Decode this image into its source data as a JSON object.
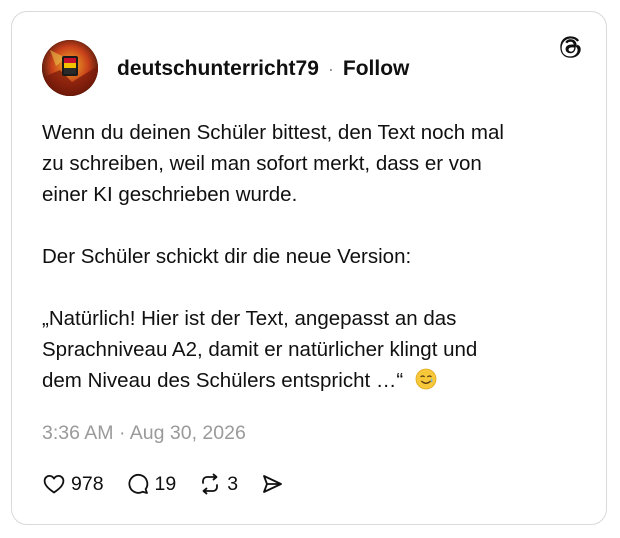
{
  "post": {
    "username": "deutschunterricht79",
    "separator": "·",
    "follow_label": "Follow",
    "paragraphs": [
      [
        "Wenn du deinen Schüler bittest, den Text noch mal",
        "zu schreiben, weil man sofort merkt, dass er von",
        "einer KI geschrieben wurde."
      ],
      [
        "Der Schüler schickt dir die neue Version:"
      ],
      [
        "„Natürlich! Hier ist der Text, angepasst an das",
        "Sprachniveau A2, damit er natürlicher klingt und",
        "dem Niveau des Schülers entspricht …“"
      ]
    ],
    "emoji": "smiling-face-with-tear",
    "timestamp": "3:36 AM · Aug 30, 2026"
  },
  "actions": {
    "likes": "978",
    "replies": "19",
    "reposts": "3"
  },
  "icons": {
    "brand_logo": "threads-logo-icon",
    "like": "heart-icon",
    "reply": "speech-bubble-icon",
    "repost": "repost-icon",
    "share": "send-icon"
  }
}
